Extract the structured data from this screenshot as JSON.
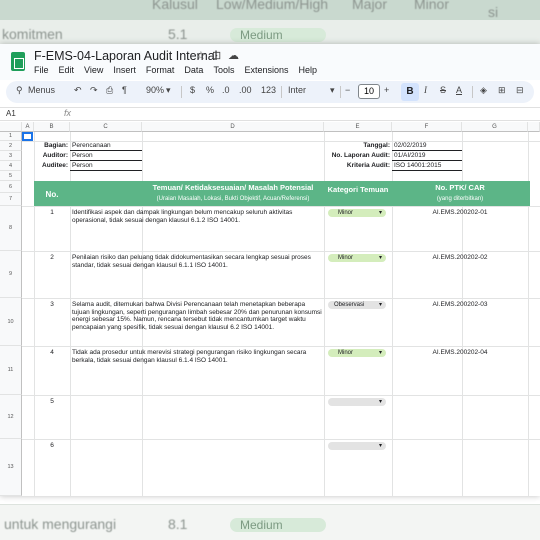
{
  "background": {
    "top_headers": [
      "Kalusul",
      "Low/Medium/High",
      "Major",
      "Minor",
      "si"
    ],
    "top_row": {
      "text": "komitmen",
      "num": "5.1",
      "pill": "Medium"
    },
    "bottom_row": {
      "text": "untuk mengurangi",
      "num": "8.1",
      "pill": "Medium"
    }
  },
  "window": {
    "title": "F-EMS-04-Laporan Audit Internal",
    "title_icons": [
      "star-icon",
      "folder-move-icon",
      "cloud-icon"
    ],
    "menu": [
      "File",
      "Edit",
      "View",
      "Insert",
      "Format",
      "Data",
      "Tools",
      "Extensions",
      "Help"
    ]
  },
  "toolbar": {
    "menus": "Menus",
    "zoom": "90%",
    "currency": "$",
    "percent": "%",
    "dec_dec": ".0",
    "dec_inc": ".00",
    "number_format": "123",
    "font": "Inter",
    "font_size": "10",
    "bold": "B",
    "italic": "I",
    "strike": "S",
    "text_color": "A"
  },
  "formula_bar": {
    "cell_ref": "A1",
    "fx": "fx",
    "value": ""
  },
  "columns": [
    "A",
    "B",
    "C",
    "D",
    "E",
    "F",
    "G"
  ],
  "rows": [
    "1",
    "2",
    "3",
    "4",
    "5",
    "6",
    "7",
    "8",
    "9",
    "10",
    "11",
    "12",
    "13"
  ],
  "header_info": {
    "bagian_label": "Bagian:",
    "bagian_value": "Perencanaan",
    "auditor_label": "Auditor:",
    "auditor_value": "Person",
    "auditee_label": "Auditee:",
    "auditee_value": "Person",
    "tanggal_label": "Tanggal:",
    "tanggal_value": "02/02/2019",
    "no_laporan_label": "No. Laporan Audit:",
    "no_laporan_value": "01/AI/2019",
    "kriteria_label": "Kriteria Audit:",
    "kriteria_value": "ISO 14001:2015"
  },
  "table_header": {
    "no": "No.",
    "temuan": "Temuan/ Ketidaksesuaian/ Masalah Potensial",
    "temuan_sub": "(Uraian Masalah, Lokasi, Bukti Objektif, Acuan/Referensi)",
    "kategori": "Kategori Temuan",
    "ptk": "No. PTK/ CAR",
    "ptk_sub": "(yang diterbitkan)"
  },
  "findings": [
    {
      "no": "1",
      "text": "Identifikasi aspek dan dampak lingkungan belum mencakup seluruh aktivitas operasional, tidak sesuai dengan klausul 6.1.2 ISO 14001.",
      "kategori": "Minor",
      "ptk": "AI.EMS.200202-01"
    },
    {
      "no": "2",
      "text": "Penilaian risiko dan peluang tidak didokumentasikan secara lengkap sesuai proses standar, tidak sesuai dengan klausul 6.1.1 ISO 14001.",
      "kategori": "Minor",
      "ptk": "AI.EMS.200202-02"
    },
    {
      "no": "3",
      "text": "Selama audit, ditemukan bahwa Divisi Perencanaan telah menetapkan beberapa tujuan lingkungan, seperti pengurangan limbah sebesar 20% dan penurunan konsumsi energi sebesar 15%. Namun, rencana tersebut tidak mencantumkan target waktu pencapaian yang spesifik, tidak sesuai dengan klausul 6.2 ISO 14001.",
      "kategori": "Obeservasi",
      "ptk": "AI.EMS.200202-03"
    },
    {
      "no": "4",
      "text": "Tidak ada prosedur untuk merevisi strategi pengurangan risiko lingkungan secara berkala, tidak sesuai dengan klausul 6.1.4 ISO 14001.",
      "kategori": "Minor",
      "ptk": "AI.EMS.200202-04"
    },
    {
      "no": "5",
      "text": "",
      "kategori": "",
      "ptk": ""
    },
    {
      "no": "6",
      "text": "",
      "kategori": "",
      "ptk": ""
    }
  ],
  "colors": {
    "accent_green": "#5cb587",
    "pill_green": "#d4edbc",
    "bold_active": "#d3e3fd"
  }
}
